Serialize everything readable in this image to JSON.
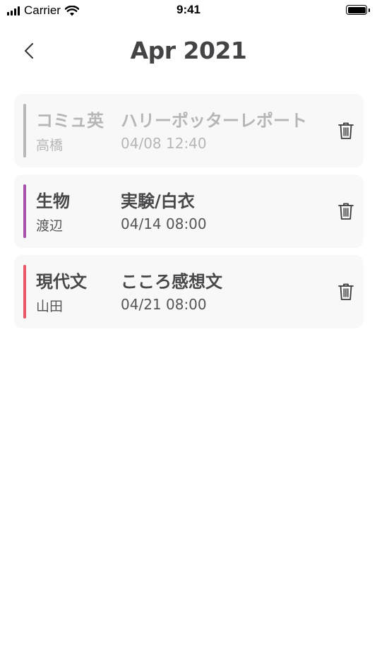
{
  "status_bar": {
    "carrier": "Carrier",
    "time": "9:41"
  },
  "header": {
    "title": "Apr 2021",
    "back_icon": "chevron-left-icon"
  },
  "tasks": [
    {
      "subject": "コミュ英",
      "teacher": "高橋",
      "title": "ハリーポッターレポート",
      "due": "04/08 12:40",
      "accent_color": "#b8b8bb",
      "completed": true
    },
    {
      "subject": "生物",
      "teacher": "渡辺",
      "title": "実験/白衣",
      "due": "04/14 08:00",
      "accent_color": "#a552a8",
      "completed": false
    },
    {
      "subject": "現代文",
      "teacher": "山田",
      "title": "こころ感想文",
      "due": "04/21 08:00",
      "accent_color": "#e85866",
      "completed": false
    }
  ],
  "delete_icon": "trash-icon"
}
